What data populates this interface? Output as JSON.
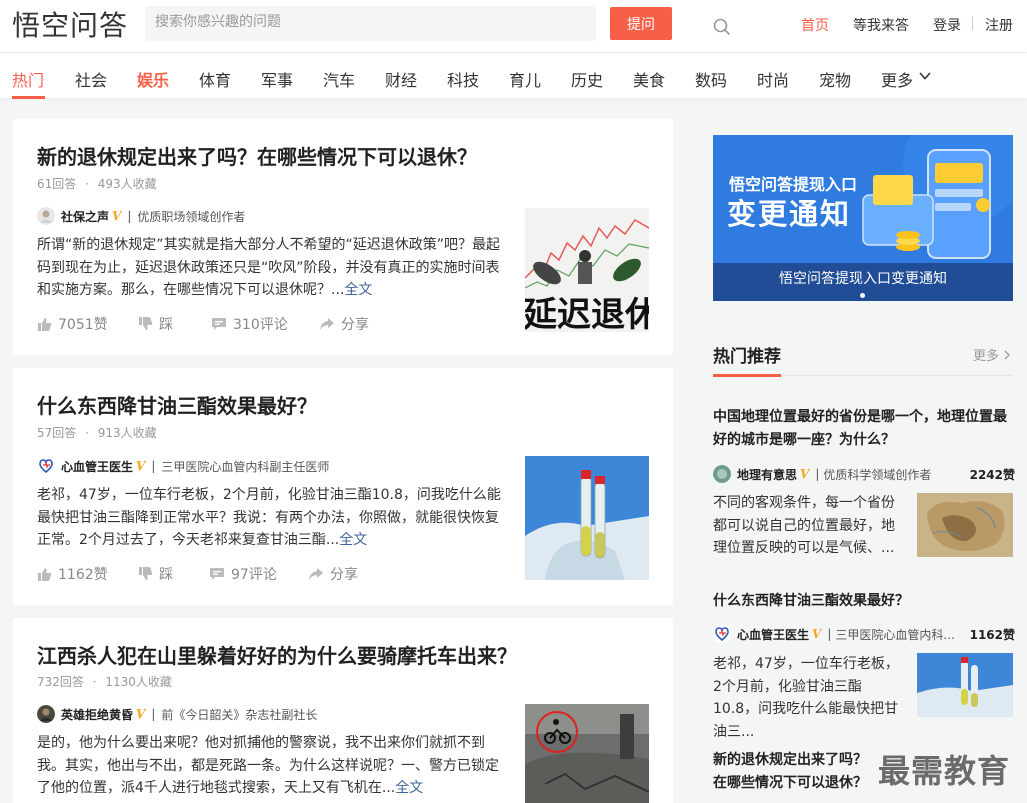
{
  "header": {
    "logo": "悟空问答",
    "search_placeholder": "搜索你感兴趣的问题",
    "ask_label": "提问",
    "nav": [
      "首页",
      "等我来答",
      "登录",
      "注册"
    ]
  },
  "channels": [
    "热门",
    "社会",
    "娱乐",
    "体育",
    "军事",
    "汽车",
    "财经",
    "科技",
    "育儿",
    "历史",
    "美食",
    "数码",
    "时尚",
    "宠物",
    "更多"
  ],
  "feed": [
    {
      "title": "新的退休规定出来了吗？在哪些情况下可以退休？",
      "answers": "61回答",
      "favorites": "493人收藏",
      "author": "社保之声",
      "author_title": "优质职场领域创作者",
      "excerpt": "所谓“新的退休规定”其实就是指大部分人不希望的“延迟退休政策”吧？最起码到现在为止，延迟退休政策还只是“吹风”阶段，并没有真正的实施时间表和实施方案。那么，在哪些情况下可以退休呢？...",
      "full_label": "全文",
      "likes": "7051赞",
      "dislike": "踩",
      "comments": "310评论",
      "share": "分享",
      "thumb_text": "延迟退休"
    },
    {
      "title": "什么东西降甘油三酯效果最好？",
      "answers": "57回答",
      "favorites": "913人收藏",
      "author": "心血管王医生",
      "author_title": "三甲医院心血管内科副主任医师",
      "excerpt": "老祁，47岁，一位车行老板，2个月前，化验甘油三酯10.8，问我吃什么能最快把甘油三酯降到正常水平？我说：有两个办法，你照做，就能很快恢复正常。2个月过去了，今天老祁来复查甘油三酯...",
      "full_label": "全文",
      "likes": "1162赞",
      "dislike": "踩",
      "comments": "97评论",
      "share": "分享"
    },
    {
      "title": "江西杀人犯在山里躲着好好的为什么要骑摩托车出来？",
      "answers": "732回答",
      "favorites": "1130人收藏",
      "author": "英雄拒绝黄昏",
      "author_title": "前《今日韶关》杂志社副社长",
      "excerpt": "是的，他为什么要出来呢？他对抓捕他的警察说，我不出来你们就抓不到我。其实，他出与不出，都是死路一条。为什么这样说呢？一、警方已锁定了他的位置，派4千人进行地毯式搜索，天上又有飞机在...",
      "full_label": "全文"
    }
  ],
  "sidebar": {
    "banner_line1": "悟空问答提现入口",
    "banner_line2": "变更通知",
    "banner_caption": "悟空问答提现入口变更通知",
    "hot_title": "热门推荐",
    "more_label": "更多",
    "items": [
      {
        "question": "中国地理位置最好的省份是哪一个，地理位置最好的城市是哪一座？为什么？",
        "author": "地理有意思",
        "author_title": "优质科学领域创作者",
        "count": "2242赞",
        "excerpt": "不同的客观条件，每一个省份都可以说自己的位置最好，地理位置反映的可以是气候、..."
      },
      {
        "question": "什么东西降甘油三酯效果最好？",
        "author": "心血管王医生",
        "author_title": "三甲医院心血管内科...",
        "count": "1162赞",
        "excerpt": "老祁，47岁，一位车行老板，2个月前，化验甘油三酯10.8，问我吃什么能最快把甘油三..."
      },
      {
        "question": "新的退休规定出来了吗？在哪些情况下可以退休？"
      }
    ]
  },
  "watermark": "最需教育",
  "colors": {
    "accent": "#f85f48",
    "link": "#406599",
    "vip": "#f5a623"
  }
}
